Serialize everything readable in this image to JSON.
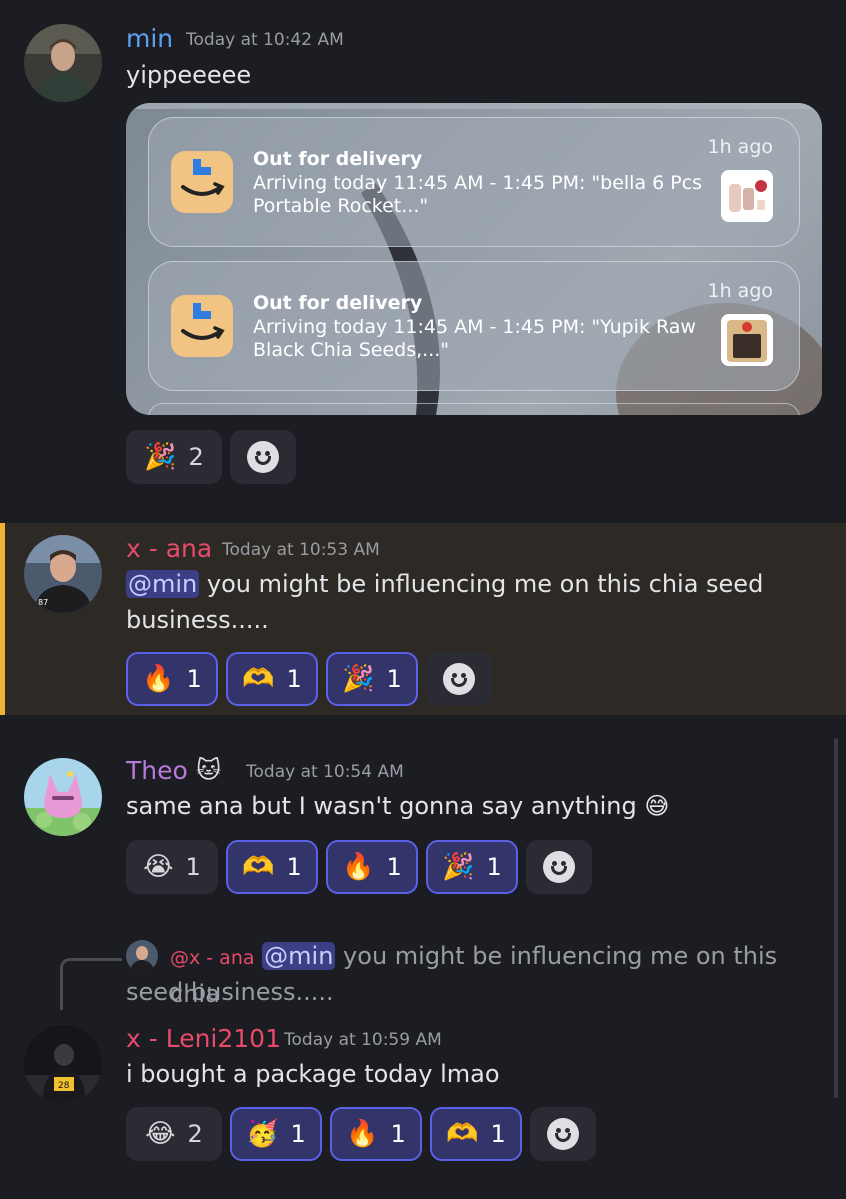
{
  "messages": [
    {
      "author": "min",
      "author_color": "#5ea0ef",
      "timestamp": "Today at 10:42 AM",
      "text": "yippeeeee",
      "embed": {
        "notifications": [
          {
            "title": "Out for delivery",
            "body": "Arriving today 11:45 AM - 1:45 PM: \"bella 6 Pcs Portable Rocket...\"",
            "time": "1h ago"
          },
          {
            "title": "Out for delivery",
            "body": "Arriving today 11:45 AM - 1:45 PM: \"Yupik Raw Black Chia Seeds,...\"",
            "time": "1h ago"
          }
        ]
      },
      "reactions": [
        {
          "emoji": "🎉",
          "count": "2",
          "active": false
        }
      ]
    },
    {
      "author": "x - ana",
      "author_color": "#e84a6a",
      "timestamp": "Today at 10:53 AM",
      "mention": "@min",
      "text": " you might be influencing me on this chia seed business.....",
      "highlighted": true,
      "reactions": [
        {
          "emoji": "🔥",
          "count": "1",
          "active": true
        },
        {
          "emoji": "🫶",
          "count": "1",
          "active": true
        },
        {
          "emoji": "🎉",
          "count": "1",
          "active": true
        }
      ]
    },
    {
      "author": "Theo",
      "author_badge": "🐱",
      "author_color": "#b77ad9",
      "timestamp": "Today at 10:54 AM",
      "text": "same ana but I wasn't gonna say anything",
      "text_emoji": "😅",
      "reactions": [
        {
          "emoji": "😭",
          "count": "1",
          "active": false
        },
        {
          "emoji": "🫶",
          "count": "1",
          "active": true
        },
        {
          "emoji": "🔥",
          "count": "1",
          "active": true
        },
        {
          "emoji": "🎉",
          "count": "1",
          "active": true
        }
      ]
    },
    {
      "reply": {
        "author": "@x - ana",
        "mention": "@min",
        "text_line1": " you might be influencing me on this chia",
        "text_line2": "seed business....."
      },
      "author": "x - Leni2101",
      "author_color": "#e84a6a",
      "timestamp": "Today at 10:59 AM",
      "text": "i bought a package today lmao",
      "reactions": [
        {
          "emoji": "😂",
          "count": "2",
          "active": false
        },
        {
          "emoji": "🥳",
          "count": "1",
          "active": true
        },
        {
          "emoji": "🔥",
          "count": "1",
          "active": true
        },
        {
          "emoji": "🫶",
          "count": "1",
          "active": true
        }
      ]
    }
  ],
  "icons": {
    "add_reaction": "smiley-icon",
    "app_icon": "amazon-app-icon"
  }
}
